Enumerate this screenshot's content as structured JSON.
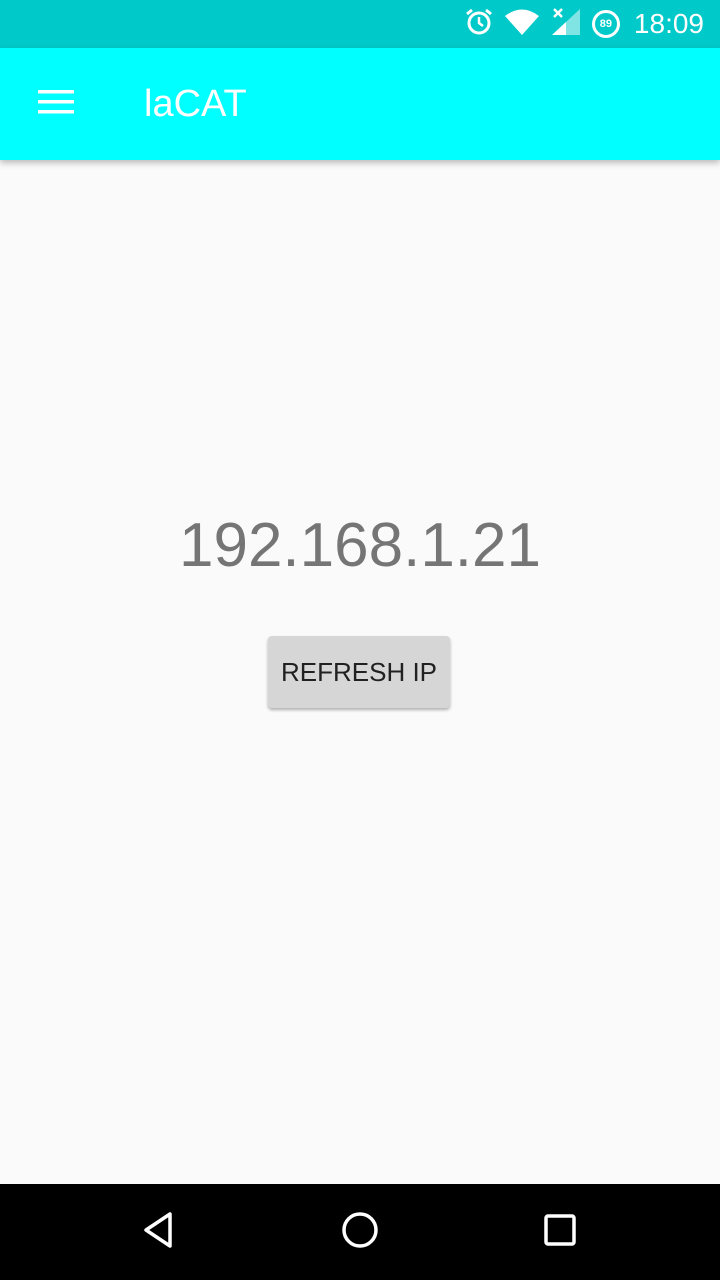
{
  "status_bar": {
    "time": "18:09",
    "battery_level": "89",
    "icons": [
      "alarm-icon",
      "wifi-icon",
      "cell-signal-icon",
      "battery-icon"
    ]
  },
  "app_bar": {
    "title": "laCAT",
    "menu_icon": "hamburger-menu-icon",
    "background_color": "#00ffff"
  },
  "main": {
    "ip_address": "192.168.1.21",
    "refresh_button_label": "REFRESH IP"
  },
  "nav_bar": {
    "buttons": [
      "back-icon",
      "home-icon",
      "recents-icon"
    ]
  }
}
